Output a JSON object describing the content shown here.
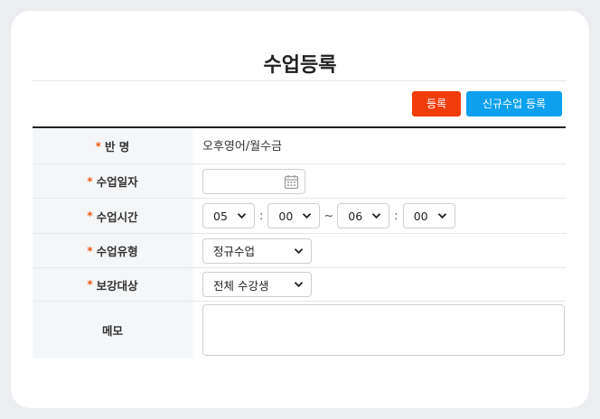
{
  "page": {
    "title": "수업등록"
  },
  "toolbar": {
    "register_label": "등록",
    "new_class_register_label": "신규수업 등록"
  },
  "form": {
    "required_mark": "*",
    "class_name": {
      "label": "반 명",
      "value": "오후영어/월수금"
    },
    "class_date": {
      "label": "수업일자",
      "value": "",
      "icon": "calendar-icon"
    },
    "class_time": {
      "label": "수업시간",
      "start_hour": "05",
      "start_minute": "00",
      "end_hour": "06",
      "end_minute": "00",
      "separator": ":",
      "range_separator": "~"
    },
    "class_type": {
      "label": "수업유형",
      "value": "정규수업"
    },
    "makeup_target": {
      "label": "보강대상",
      "value": "전체 수강생"
    },
    "memo": {
      "label": "메모",
      "value": ""
    }
  },
  "colors": {
    "register_button": "#f23c0a",
    "new_class_button": "#0ca0ef",
    "required_mark": "#f05a1a",
    "label_background": "#f5f6f8"
  }
}
